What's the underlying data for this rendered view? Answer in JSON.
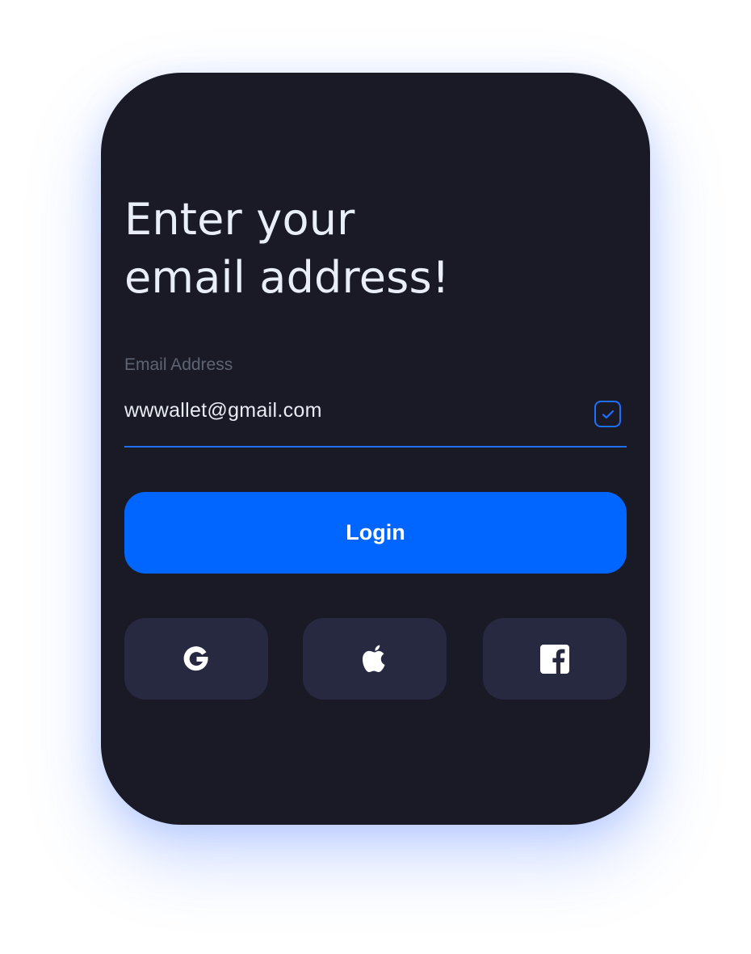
{
  "login": {
    "title_line1": "Enter your",
    "title_line2": "email address!",
    "email_label": "Email Address",
    "email_value": "wwwallet@gmail.com",
    "login_label": "Login"
  },
  "social": [
    {
      "icon": "google-icon"
    },
    {
      "icon": "apple-icon"
    },
    {
      "icon": "facebook-icon"
    }
  ],
  "colors": {
    "card_background": "#191a26",
    "accent": "#0066ff",
    "social_button_background": "#272940",
    "title_text": "#e9eef8",
    "label_text": "#5f6474"
  }
}
